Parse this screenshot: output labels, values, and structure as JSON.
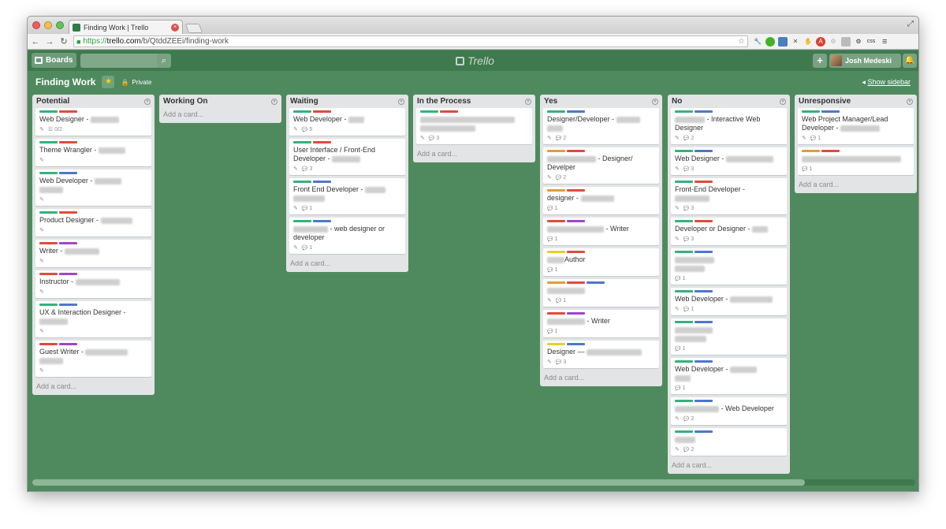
{
  "browser": {
    "tab_title": "Finding Work | Trello",
    "url_scheme": "https://",
    "url_host": "trello.com",
    "url_path": "/b/QtddZEEi/finding-work"
  },
  "header": {
    "boards_label": "Boards",
    "logo_text": "Trello",
    "member_name": "Josh Medeski"
  },
  "board": {
    "title": "Finding Work",
    "privacy": "Private",
    "show_sidebar": "Show sidebar"
  },
  "colors": {
    "board_bg": "#4f8a5e",
    "header_bg": "#3f7a4e",
    "label_green": "#34b27d",
    "label_red": "#e24a3c",
    "label_blue": "#4d77cb",
    "label_orange": "#e09d3c",
    "label_purple": "#9f46c8",
    "label_yellow": "#e6cf2b"
  },
  "add_card_label": "Add a card...",
  "lists": [
    {
      "name": "Potential",
      "cards": [
        {
          "labels": [
            "green",
            "red"
          ],
          "title": "Web Designer - ",
          "blur": 36,
          "edit": true,
          "checklist": "0/2"
        },
        {
          "labels": [
            "green",
            "red"
          ],
          "title": "Theme Wrangler - ",
          "blur": 34,
          "edit": true
        },
        {
          "labels": [
            "green",
            "blue"
          ],
          "title": "Web Developer - ",
          "blur": 34,
          "extra": 30,
          "edit": true
        },
        {
          "labels": [
            "green",
            "red"
          ],
          "title": "Product Designer - ",
          "blur": 40,
          "edit": true
        },
        {
          "labels": [
            "red",
            "purple"
          ],
          "title": "Writer - ",
          "blur": 44,
          "edit": true
        },
        {
          "labels": [
            "red",
            "purple"
          ],
          "title": "Instructor - ",
          "blur": 56,
          "edit": true
        },
        {
          "labels": [
            "green",
            "blue"
          ],
          "title": "UX & Interaction Designer - ",
          "blur": 0,
          "extra": 36,
          "edit": true
        },
        {
          "labels": [
            "red",
            "purple"
          ],
          "title": "Guest Writer - ",
          "blur": 54,
          "extra": 30,
          "edit": true
        }
      ]
    },
    {
      "name": "Working On",
      "cards": []
    },
    {
      "name": "Waiting",
      "cards": [
        {
          "labels": [
            "green",
            "red"
          ],
          "title": "Web Developer - ",
          "blur": 20,
          "edit": true,
          "comments": "5"
        },
        {
          "labels": [
            "green",
            "red"
          ],
          "title": "User Interface / Front-End Developer - ",
          "blur": 36,
          "edit": true,
          "comments": "3"
        },
        {
          "labels": [
            "green",
            "blue"
          ],
          "title": "Front End Developer - ",
          "blur": 26,
          "extra": 40,
          "edit": true,
          "comments": "1"
        },
        {
          "labels": [
            "green",
            "blue"
          ],
          "title": " - web designer or developer",
          "lead": 44,
          "blur": 0,
          "edit": true,
          "comments": "1"
        }
      ]
    },
    {
      "name": "In the Process",
      "cards": [
        {
          "labels": [
            "green",
            "red"
          ],
          "title": "",
          "lead": 120,
          "blur": 0,
          "edit": true,
          "comments": "3",
          "tall": true
        }
      ]
    },
    {
      "name": "Yes",
      "cards": [
        {
          "labels": [
            "green",
            "blue"
          ],
          "title": "Designer/Developer - ",
          "blur": 30,
          "extra": 20,
          "edit": true,
          "comments": "2"
        },
        {
          "labels": [
            "orange",
            "red"
          ],
          "title": " - Designer/ Develper",
          "lead": 62,
          "blur": 0,
          "edit": true,
          "comments": "2"
        },
        {
          "labels": [
            "orange",
            "red"
          ],
          "title": "designer - ",
          "blur": 42,
          "comments": "1"
        },
        {
          "labels": [
            "red",
            "purple"
          ],
          "title": " - Writer",
          "lead": 72,
          "blur": 0,
          "comments": "1"
        },
        {
          "labels": [
            "yellow",
            "red"
          ],
          "title": "Author",
          "lead": 22,
          "blur": 0,
          "comments": "1"
        },
        {
          "labels": [
            "orange",
            "red",
            "blue"
          ],
          "title": "",
          "lead": 48,
          "blur": 0,
          "edit": true,
          "comments": "1"
        },
        {
          "labels": [
            "red",
            "purple"
          ],
          "title": " - Writer",
          "lead": 48,
          "blur": 0,
          "comments": "1"
        },
        {
          "labels": [
            "yellow",
            "blue"
          ],
          "title": "Designer — ",
          "blur": 70,
          "edit": true,
          "comments": "3"
        }
      ]
    },
    {
      "name": "No",
      "cards": [
        {
          "labels": [
            "green",
            "blue"
          ],
          "title": " - Interactive Web Designer",
          "lead": 38,
          "blur": 0,
          "edit": true,
          "comments": "2"
        },
        {
          "labels": [
            "green",
            "blue"
          ],
          "title": "Web Designer - ",
          "blur": 60,
          "edit": true,
          "comments": "3"
        },
        {
          "labels": [
            "green",
            "red"
          ],
          "title": "Front-End Developer - ",
          "blur": 0,
          "extra": 44,
          "edit": true,
          "comments": "3"
        },
        {
          "labels": [
            "green",
            "red"
          ],
          "title": "Developer or Designer - ",
          "blur": 20,
          "edit": true,
          "comments": "3"
        },
        {
          "labels": [
            "green",
            "blue"
          ],
          "title": "",
          "lead": 50,
          "blur": 0,
          "extra": 38,
          "comments": "1"
        },
        {
          "labels": [
            "green",
            "blue"
          ],
          "title": "Web Developer - ",
          "blur": 54,
          "edit": true,
          "comments": "1"
        },
        {
          "labels": [
            "green",
            "blue"
          ],
          "title": "",
          "lead": 48,
          "blur": 0,
          "extra": 40,
          "comments": "1"
        },
        {
          "labels": [
            "green",
            "blue"
          ],
          "title": "Web Developer - ",
          "blur": 34,
          "extra": 20,
          "comments": "1"
        },
        {
          "labels": [
            "green",
            "blue"
          ],
          "title": " - Web Developer",
          "lead": 56,
          "blur": 0,
          "edit": true,
          "comments": "2"
        },
        {
          "labels": [
            "green",
            "blue"
          ],
          "title": "",
          "lead": 26,
          "blur": 0,
          "edit": true,
          "comments": "2"
        }
      ]
    },
    {
      "name": "Unresponsive",
      "cards": [
        {
          "labels": [
            "green",
            "blue"
          ],
          "title": "Web Project Manager/Lead Developer - ",
          "blur": 50,
          "edit": true,
          "comments": "1"
        },
        {
          "labels": [
            "orange",
            "red"
          ],
          "title": "",
          "lead": 126,
          "blur": 0,
          "comments": "1"
        }
      ]
    }
  ]
}
